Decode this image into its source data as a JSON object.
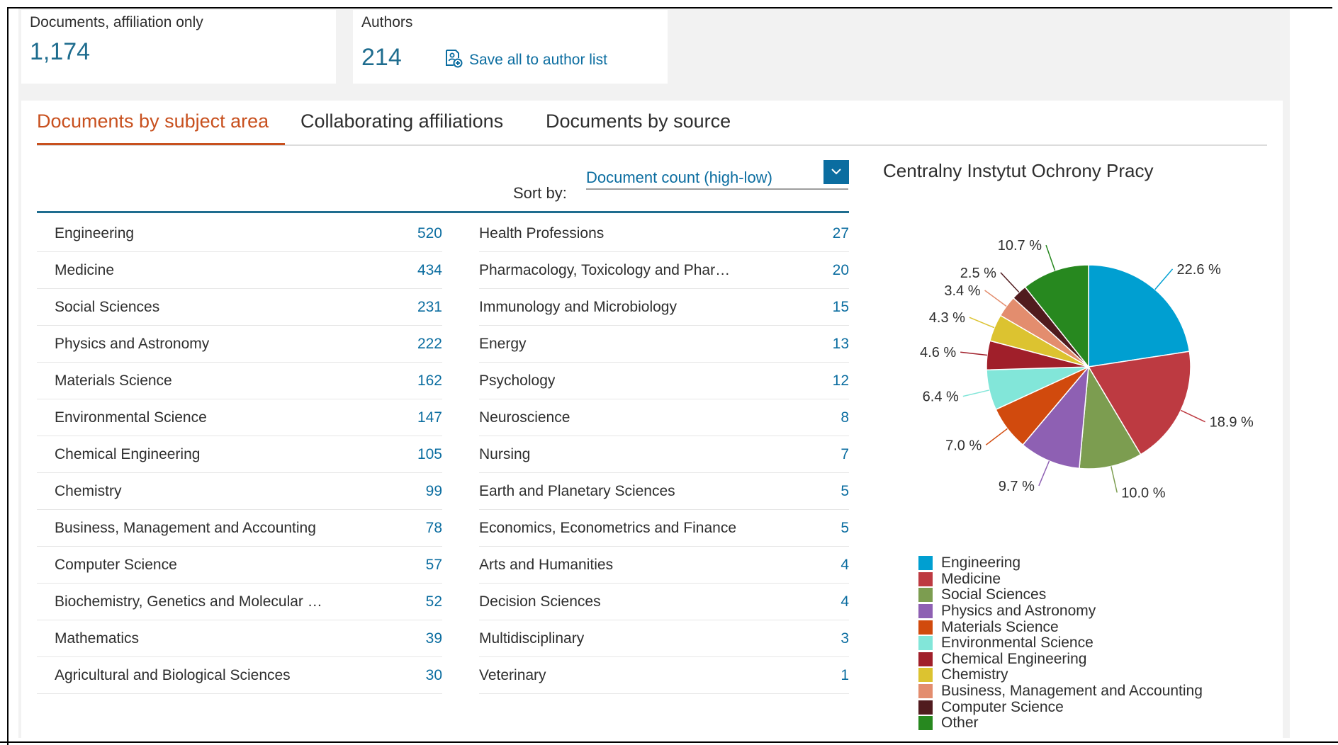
{
  "summary": {
    "documents_label": "Documents, affiliation only",
    "documents_value": "1,174",
    "authors_label": "Authors",
    "authors_value": "214",
    "save_authors_label": "Save all to author list"
  },
  "tabs": [
    {
      "label": "Documents by subject area",
      "active": true
    },
    {
      "label": "Collaborating affiliations",
      "active": false
    },
    {
      "label": "Documents by source",
      "active": false
    }
  ],
  "sort": {
    "label": "Sort by:",
    "value": "Document count (high-low)"
  },
  "subjects_left": [
    {
      "name": "Engineering",
      "count": "520"
    },
    {
      "name": "Medicine",
      "count": "434"
    },
    {
      "name": "Social Sciences",
      "count": "231"
    },
    {
      "name": "Physics and Astronomy",
      "count": "222"
    },
    {
      "name": "Materials Science",
      "count": "162"
    },
    {
      "name": "Environmental Science",
      "count": "147"
    },
    {
      "name": "Chemical Engineering",
      "count": "105"
    },
    {
      "name": "Chemistry",
      "count": "99"
    },
    {
      "name": "Business, Management and Accounting",
      "count": "78"
    },
    {
      "name": "Computer Science",
      "count": "57"
    },
    {
      "name": "Biochemistry, Genetics and Molecular …",
      "count": "52"
    },
    {
      "name": "Mathematics",
      "count": "39"
    },
    {
      "name": "Agricultural and Biological Sciences",
      "count": "30"
    }
  ],
  "subjects_right": [
    {
      "name": "Health Professions",
      "count": "27"
    },
    {
      "name": "Pharmacology, Toxicology and Phar…",
      "count": "20"
    },
    {
      "name": "Immunology and Microbiology",
      "count": "15"
    },
    {
      "name": "Energy",
      "count": "13"
    },
    {
      "name": "Psychology",
      "count": "12"
    },
    {
      "name": "Neuroscience",
      "count": "8"
    },
    {
      "name": "Nursing",
      "count": "7"
    },
    {
      "name": "Earth and Planetary Sciences",
      "count": "5"
    },
    {
      "name": "Economics, Econometrics and Finance",
      "count": "5"
    },
    {
      "name": "Arts and Humanities",
      "count": "4"
    },
    {
      "name": "Decision Sciences",
      "count": "4"
    },
    {
      "name": "Multidisciplinary",
      "count": "3"
    },
    {
      "name": "Veterinary",
      "count": "1"
    }
  ],
  "chart_data": {
    "type": "pie",
    "title": "Centralny Instytut Ochrony Pracy",
    "legend_position": "bottom",
    "slices": [
      {
        "label": "Engineering",
        "value": 22.6,
        "display": "22.6 %",
        "color": "#009fd1"
      },
      {
        "label": "Medicine",
        "value": 18.9,
        "display": "18.9 %",
        "color": "#bd3a41"
      },
      {
        "label": "Social Sciences",
        "value": 10.0,
        "display": "10.0 %",
        "color": "#7c9d50"
      },
      {
        "label": "Physics and Astronomy",
        "value": 9.7,
        "display": "9.7 %",
        "color": "#8e60b3"
      },
      {
        "label": "Materials Science",
        "value": 7.0,
        "display": "7.0 %",
        "color": "#d14a0d"
      },
      {
        "label": "Environmental Science",
        "value": 6.4,
        "display": "6.4 %",
        "color": "#82e6d9"
      },
      {
        "label": "Chemical Engineering",
        "value": 4.6,
        "display": "4.6 %",
        "color": "#a01f2a"
      },
      {
        "label": "Chemistry",
        "value": 4.3,
        "display": "4.3 %",
        "color": "#dcc330"
      },
      {
        "label": "Business, Management and Accounting",
        "value": 3.4,
        "display": "3.4 %",
        "color": "#e38d6e"
      },
      {
        "label": "Computer Science",
        "value": 2.5,
        "display": "2.5 %",
        "color": "#501b1e"
      },
      {
        "label": "Other",
        "value": 10.7,
        "display": "10.7 %",
        "color": "#27881f"
      }
    ]
  },
  "colors": {
    "accent_tab": "#c8501e",
    "link": "#0b6da0",
    "value": "#1f6d8f"
  },
  "icons": {
    "save": "save-to-list-icon",
    "sort": "chevron-down-icon"
  }
}
